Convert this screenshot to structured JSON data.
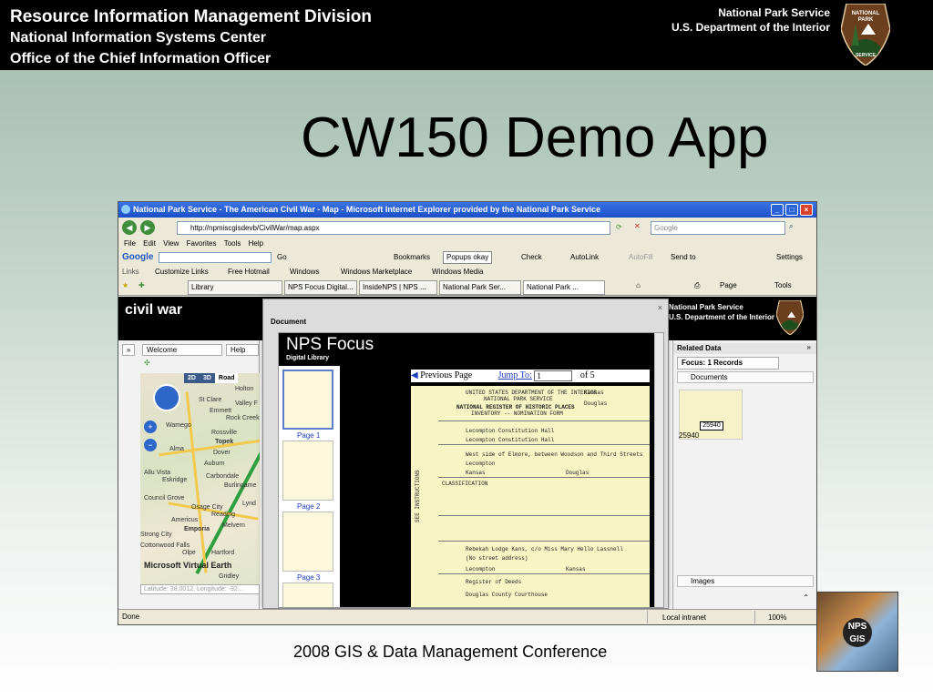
{
  "header": {
    "line1": "Resource Information Management Division",
    "line2": "National Information Systems Center",
    "line3": "Office of the Chief Information Officer",
    "agency": "National Park Service",
    "department": "U.S. Department of the Interior",
    "logo_text": "NATIONAL PARK SERVICE"
  },
  "slide_title": "CW150 Demo App",
  "footer": "2008 GIS & Data Management Conference",
  "photo_badge": "NPS GIS",
  "browser": {
    "window_title": "National Park Service - The American Civil War - Map - Microsoft Internet Explorer provided by the National Park Service",
    "url": "http://npmiscgisdevb/CivilWar/map.aspx",
    "search_placeholder": "Google",
    "menus": [
      "File",
      "Edit",
      "View",
      "Favorites",
      "Tools",
      "Help"
    ],
    "google_toolbar": {
      "logo": "Google",
      "go": "Go",
      "bookmarks": "Bookmarks",
      "popups": "Popups okay",
      "check": "Check",
      "autolink": "AutoLink",
      "autofill": "AutoFill",
      "sendto": "Send to",
      "settings": "Settings"
    },
    "links_label": "Links",
    "links": [
      "Customize Links",
      "Free Hotmail",
      "Windows",
      "Windows Marketplace",
      "Windows Media"
    ],
    "tabs": [
      "Library",
      "NPS Focus Digital...",
      "InsideNPS | NPS ...",
      "National Park Ser...",
      "National Park ..."
    ],
    "cmd": {
      "page": "Page",
      "tools": "Tools"
    },
    "status_left": "Done",
    "status_zone": "Local intranet",
    "status_zoom": "100%"
  },
  "app": {
    "title": "civil war",
    "agency": "National Park Service",
    "department": "U.S. Department of the Interior",
    "left_tabs": {
      "welcome": "Welcome",
      "help": "Help"
    },
    "map_modes": [
      "2D",
      "3D",
      "Road"
    ],
    "map_cities": [
      "Holton",
      "St Clare",
      "Valley F",
      "Emmett",
      "Rock Creek",
      "Wamego",
      "Rossville",
      "Topek",
      "Alma",
      "Dover",
      "Auburn",
      "Allu Vista",
      "Eskridge",
      "Carbondale",
      "Burlingame",
      "Council Grove",
      "Osage City",
      "Lynd",
      "Reading",
      "Americus",
      "Emporia",
      "Melvern",
      "Strong City",
      "Cottonwood Falls",
      "Olpe",
      "Hartford",
      "Gridley"
    ],
    "map_brand": "Microsoft Virtual Earth",
    "latlon": "Latitude: 38.0012, Longitude: -92...",
    "right_header": "Related Data",
    "focus_tab": "Focus: 1 Records",
    "documents": "Documents",
    "images": "Images",
    "thumb_label": "25940",
    "thumb_id": "25940"
  },
  "dialog": {
    "title": "Document",
    "nps_focus": "NPS Focus",
    "digital_library": "Digital Library",
    "prev_page": "Previous Page",
    "jump_to": "Jump To:",
    "page_value": "1",
    "of_pages": "of 5",
    "page_labels": [
      "Page 1",
      "Page 2",
      "Page 3"
    ],
    "doc_lines": [
      "UNITED STATES DEPARTMENT OF THE INTERIOR",
      "NATIONAL PARK SERVICE",
      "NATIONAL REGISTER OF HISTORIC PLACES",
      "INVENTORY -- NOMINATION FORM",
      "Kansas",
      "Douglas",
      "Lecompton Constitution Hall",
      "Lecompton Constitution Hall",
      "West side of Elmore, between Woodson and Third Streets",
      "Lecompton",
      "Kansas",
      "Douglas",
      "CLASSIFICATION",
      "Rebekah Lodge Kans, c/o Miss Mary Hello Lassnell",
      "(No street address)",
      "Lecompton",
      "Kansas",
      "Register of Deeds",
      "Douglas County Courthouse",
      "SEE INSTRUCTIONS"
    ]
  }
}
